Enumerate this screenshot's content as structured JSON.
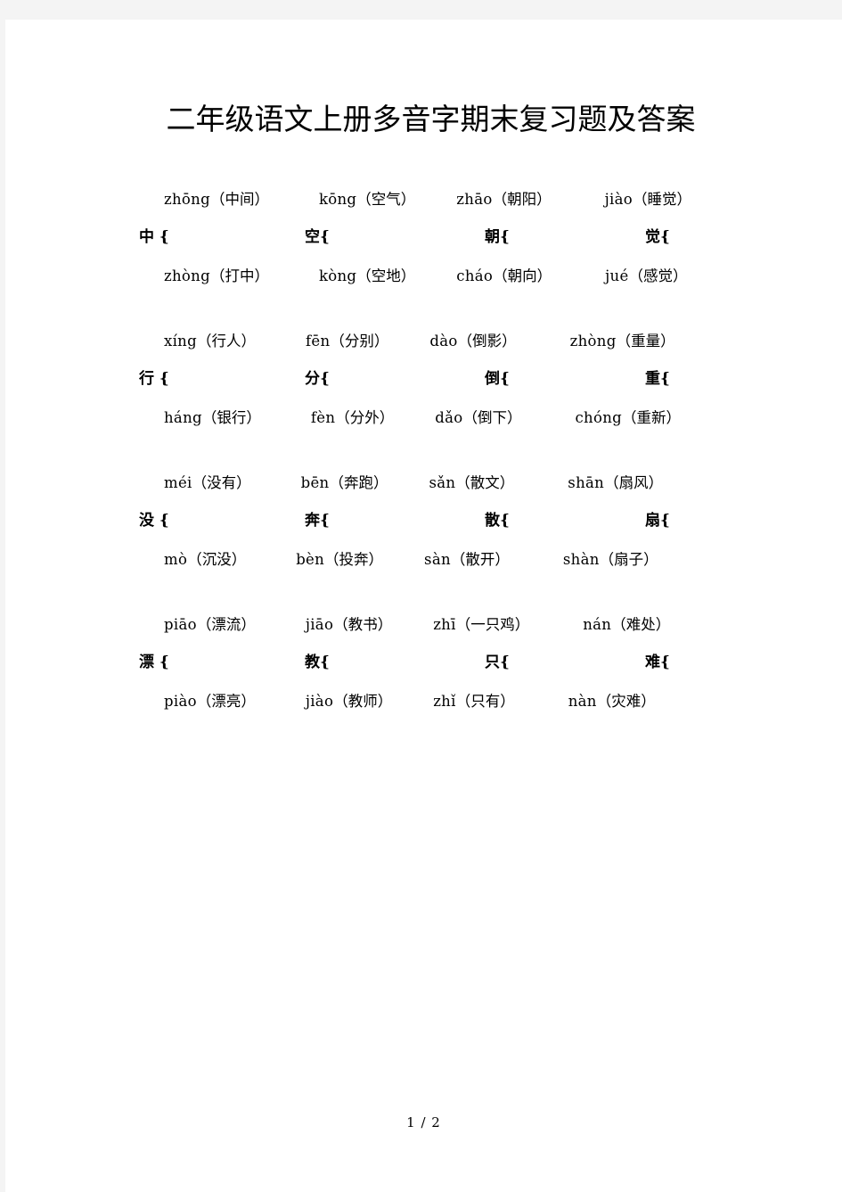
{
  "document": {
    "title": "二年级语文上册多音字期末复习题及答案",
    "footer": "1 / 2"
  },
  "blocks": [
    {
      "id": "block-1",
      "top_row": [
        {
          "pinyin": "zhōng",
          "word": "（中间）"
        },
        {
          "pinyin": "kōng",
          "word": "（空气）"
        },
        {
          "pinyin": "zhāo",
          "word": "（朝阳）"
        },
        {
          "pinyin": "jiào",
          "word": "（睡觉）"
        }
      ],
      "characters": [
        {
          "char": "中",
          "brace": "{"
        },
        {
          "char": "空",
          "brace": "{"
        },
        {
          "char": "朝",
          "brace": "{"
        },
        {
          "char": "觉",
          "brace": "{"
        }
      ],
      "bottom_row": [
        {
          "pinyin": "zhòng",
          "word": "（打中）"
        },
        {
          "pinyin": "kòng",
          "word": "（空地）"
        },
        {
          "pinyin": "cháo",
          "word": "（朝向）"
        },
        {
          "pinyin": "jué",
          "word": "（感觉）"
        }
      ]
    },
    {
      "id": "block-2",
      "top_row": [
        {
          "pinyin": "xíng",
          "word": "（行人）"
        },
        {
          "pinyin": "fēn",
          "word": "（分别）"
        },
        {
          "pinyin": "dào",
          "word": "（倒影）"
        },
        {
          "pinyin": "zhòng",
          "word": "（重量）"
        }
      ],
      "characters": [
        {
          "char": "行",
          "brace": "{"
        },
        {
          "char": "分",
          "brace": "{"
        },
        {
          "char": "倒",
          "brace": "{"
        },
        {
          "char": "重",
          "brace": "{"
        }
      ],
      "bottom_row": [
        {
          "pinyin": "háng",
          "word": "（银行）"
        },
        {
          "pinyin": "fèn",
          "word": "（分外）"
        },
        {
          "pinyin": "dǎo",
          "word": "（倒下）"
        },
        {
          "pinyin": "chóng",
          "word": "（重新）"
        }
      ]
    },
    {
      "id": "block-3",
      "top_row": [
        {
          "pinyin": "méi",
          "word": "（没有）"
        },
        {
          "pinyin": "bēn",
          "word": "（奔跑）"
        },
        {
          "pinyin": "sǎn",
          "word": "（散文）"
        },
        {
          "pinyin": "shān",
          "word": "（扇风）"
        }
      ],
      "characters": [
        {
          "char": "没",
          "brace": "{"
        },
        {
          "char": "奔",
          "brace": "{"
        },
        {
          "char": "散",
          "brace": "{"
        },
        {
          "char": "扇",
          "brace": "{"
        }
      ],
      "bottom_row": [
        {
          "pinyin": "mò",
          "word": "（沉没）"
        },
        {
          "pinyin": "bèn",
          "word": "（投奔）"
        },
        {
          "pinyin": "sàn",
          "word": "（散开）"
        },
        {
          "pinyin": "shàn",
          "word": "（扇子）"
        }
      ]
    },
    {
      "id": "block-4",
      "top_row": [
        {
          "pinyin": "piāo",
          "word": "（漂流）"
        },
        {
          "pinyin": "jiāo",
          "word": "（教书）"
        },
        {
          "pinyin": "zhī",
          "word": "（一只鸡）"
        },
        {
          "pinyin": "nán",
          "word": "（难处）"
        }
      ],
      "characters": [
        {
          "char": "漂",
          "brace": "{"
        },
        {
          "char": "教",
          "brace": "{"
        },
        {
          "char": "只",
          "brace": "{"
        },
        {
          "char": "难",
          "brace": "{"
        }
      ],
      "bottom_row": [
        {
          "pinyin": "piào",
          "word": "（漂亮）"
        },
        {
          "pinyin": "jiào",
          "word": "（教师）"
        },
        {
          "pinyin": "zhǐ",
          "word": "（只有）"
        },
        {
          "pinyin": "nàn",
          "word": "（灾难）"
        }
      ]
    }
  ]
}
